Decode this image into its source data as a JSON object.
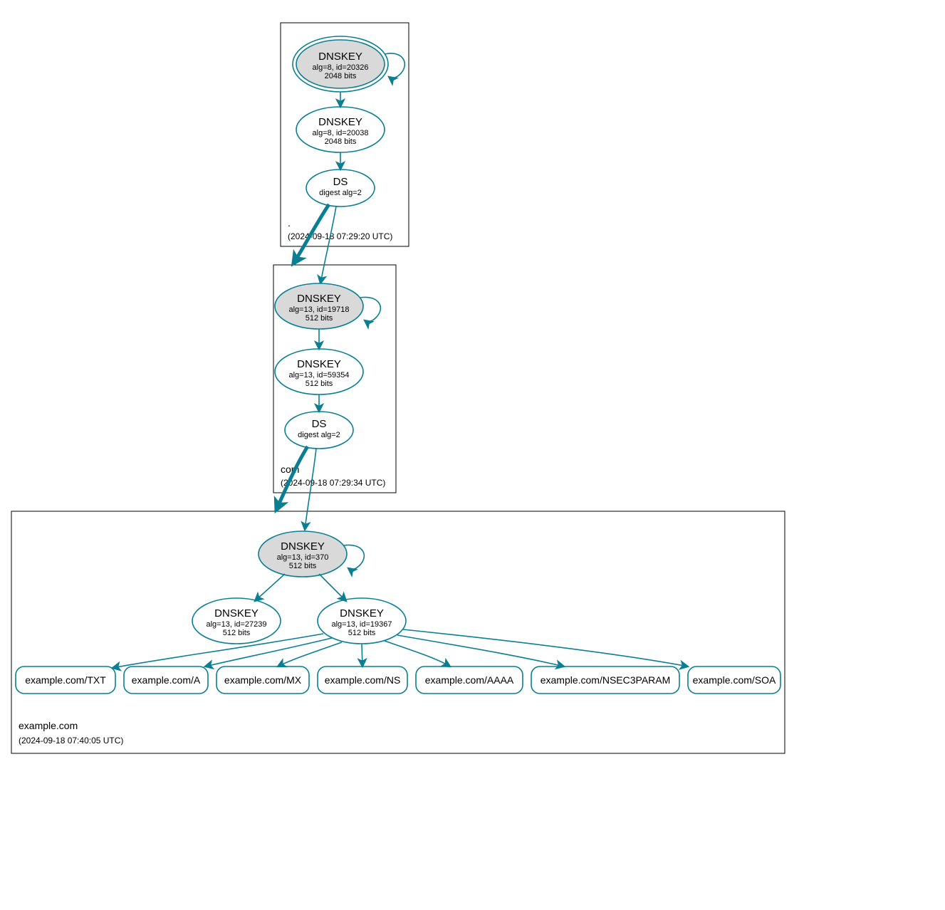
{
  "colors": {
    "accent": "#0a7f94",
    "grey_fill": "#d9d9d9"
  },
  "zones": {
    "root": {
      "name": ".",
      "timestamp": "(2024-09-18 07:29:20 UTC)"
    },
    "com": {
      "name": "com",
      "timestamp": "(2024-09-18 07:29:34 UTC)"
    },
    "example": {
      "name": "example.com",
      "timestamp": "(2024-09-18 07:40:05 UTC)"
    }
  },
  "nodes": {
    "root_ksk": {
      "title": "DNSKEY",
      "line1": "alg=8, id=20326",
      "line2": "2048 bits"
    },
    "root_zsk": {
      "title": "DNSKEY",
      "line1": "alg=8, id=20038",
      "line2": "2048 bits"
    },
    "root_ds": {
      "title": "DS",
      "line1": "digest alg=2",
      "line2": ""
    },
    "com_ksk": {
      "title": "DNSKEY",
      "line1": "alg=13, id=19718",
      "line2": "512 bits"
    },
    "com_zsk": {
      "title": "DNSKEY",
      "line1": "alg=13, id=59354",
      "line2": "512 bits"
    },
    "com_ds": {
      "title": "DS",
      "line1": "digest alg=2",
      "line2": ""
    },
    "ex_ksk": {
      "title": "DNSKEY",
      "line1": "alg=13, id=370",
      "line2": "512 bits"
    },
    "ex_zsk1": {
      "title": "DNSKEY",
      "line1": "alg=13, id=27239",
      "line2": "512 bits"
    },
    "ex_zsk2": {
      "title": "DNSKEY",
      "line1": "alg=13, id=19367",
      "line2": "512 bits"
    }
  },
  "records": {
    "txt": "example.com/TXT",
    "a": "example.com/A",
    "mx": "example.com/MX",
    "ns": "example.com/NS",
    "aaaa": "example.com/AAAA",
    "nsec": "example.com/NSEC3PARAM",
    "soa": "example.com/SOA"
  }
}
